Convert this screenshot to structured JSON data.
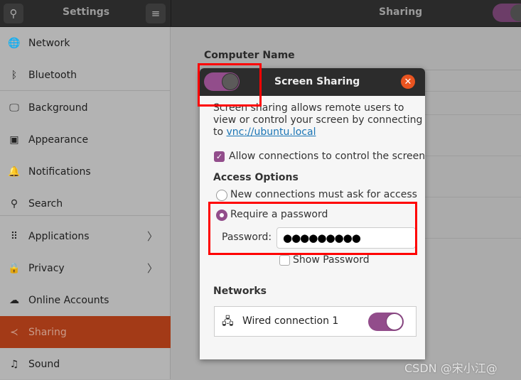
{
  "header": {
    "sidebar_title": "Settings",
    "page_title": "Sharing"
  },
  "sidebar": {
    "items": [
      {
        "label": "Network",
        "icon": "globe-icon",
        "glyph": "🌐"
      },
      {
        "label": "Bluetooth",
        "icon": "bluetooth-icon",
        "glyph": "ᛒ"
      },
      {
        "label": "Background",
        "icon": "monitor-icon",
        "glyph": "🖵"
      },
      {
        "label": "Appearance",
        "icon": "appearance-icon",
        "glyph": "▣"
      },
      {
        "label": "Notifications",
        "icon": "bell-icon",
        "glyph": "🔔"
      },
      {
        "label": "Search",
        "icon": "search-icon",
        "glyph": "⚲"
      },
      {
        "label": "Applications",
        "icon": "grid-icon",
        "glyph": "⠿"
      },
      {
        "label": "Privacy",
        "icon": "lock-icon",
        "glyph": "🔒"
      },
      {
        "label": "Online Accounts",
        "icon": "cloud-icon",
        "glyph": "☁"
      },
      {
        "label": "Sharing",
        "icon": "share-icon",
        "glyph": "≺"
      },
      {
        "label": "Sound",
        "icon": "music-note-icon",
        "glyph": "♫"
      }
    ],
    "selected": "Sharing"
  },
  "main": {
    "computer_name_label": "Computer Name"
  },
  "dialog": {
    "title": "Screen Sharing",
    "enabled": true,
    "description_1": "Screen sharing allows remote users to",
    "description_2": "view or control your screen by connecting",
    "description_3": "to ",
    "link": "vnc://ubuntu.local",
    "allow_control_label": "Allow connections to control the screen",
    "allow_control_checked": true,
    "access_options_heading": "Access Options",
    "option_ask": "New connections must ask for access",
    "option_password": "Require a password",
    "selected_option": "Require a password",
    "password_label": "Password:",
    "password_value": "●●●●●●●●●",
    "show_password_label": "Show Password",
    "show_password_checked": false,
    "networks_heading": "Networks",
    "network_name": "Wired connection 1",
    "network_enabled": true
  },
  "watermark": "CSDN @宋小江@",
  "colors": {
    "accent": "#924d8b",
    "selection": "#a33a17",
    "close": "#e95420",
    "highlight_box": "#ff0000"
  }
}
